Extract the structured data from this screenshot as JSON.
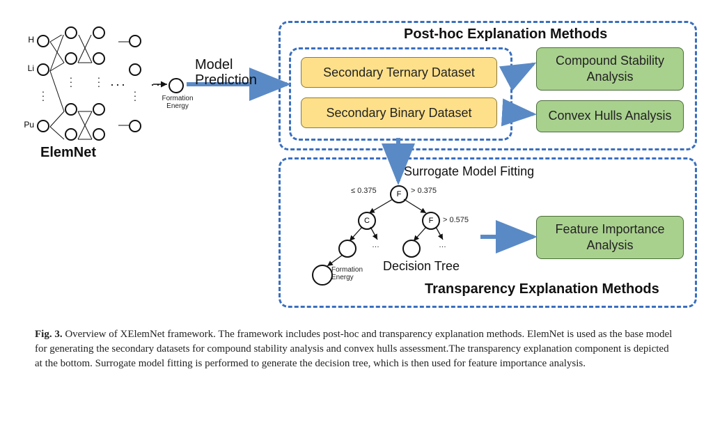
{
  "elemnet": {
    "name": "ElemNet",
    "inputs": [
      "H",
      "Li",
      "Pu"
    ],
    "output_label": "Formation Energy",
    "arrow_label": "Model Prediction"
  },
  "posthoc": {
    "title": "Post-hoc Explanation Methods",
    "ternary": "Secondary Ternary Dataset",
    "binary": "Secondary Binary Dataset",
    "stability": "Compound Stability Analysis",
    "hulls": "Convex Hulls Analysis"
  },
  "transparency": {
    "title": "Transparency Explanation Methods",
    "fitting": "Surrogate Model Fitting",
    "tree_name": "Decision Tree",
    "tree": {
      "root": "F",
      "left_thresh": "≤ 0.375",
      "right_thresh": "> 0.375",
      "left_child": "C",
      "right_child": "F",
      "rr_thresh": "> 0.575",
      "leaf_label": "Formation Energy"
    },
    "feature": "Feature Importance Analysis"
  },
  "caption": {
    "fignum": "Fig. 3.",
    "text": " Overview of XElemNet framework. The framework includes post-hoc and transparency explanation methods. ElemNet is used as the base model for generating the secondary datasets for compound stability analysis and convex hulls assessment.The transparency explanation component is depicted at the bottom. Surrogate model fitting is performed to generate the decision tree, which is then used for feature importance analysis."
  }
}
